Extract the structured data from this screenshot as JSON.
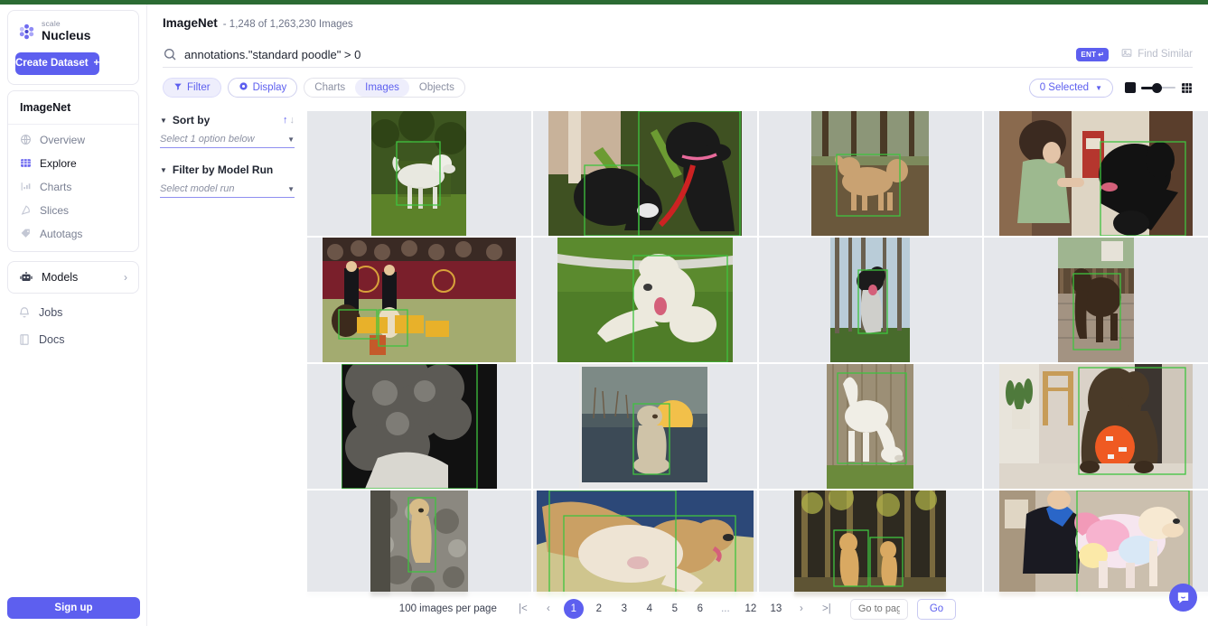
{
  "brand": {
    "company": "scale",
    "product": "Nucleus",
    "logo_icon": "scale-flower-icon"
  },
  "sidebar": {
    "create_dataset": "Create Dataset",
    "dataset_name": "ImageNet",
    "items": [
      {
        "label": "Overview",
        "icon": "globe-icon",
        "active": false
      },
      {
        "label": "Explore",
        "icon": "grid-table-icon",
        "active": true
      },
      {
        "label": "Charts",
        "icon": "bar-chart-icon",
        "active": false
      },
      {
        "label": "Slices",
        "icon": "slice-icon",
        "active": false
      },
      {
        "label": "Autotags",
        "icon": "tag-icon",
        "active": false
      }
    ],
    "models": {
      "label": "Models",
      "icon": "robot-icon",
      "chevron": "chevron-right-icon"
    },
    "lower": [
      {
        "label": "Jobs",
        "icon": "bell-icon"
      },
      {
        "label": "Docs",
        "icon": "book-icon"
      }
    ],
    "signup": "Sign up"
  },
  "header": {
    "title": "ImageNet",
    "subtitle": "- 1,248 of 1,263,230 Images"
  },
  "search": {
    "value": "annotations.\"standard poodle\" > 0",
    "icon": "search-icon",
    "ent_badge": "ENT",
    "ent_glyph": "↵",
    "find_similar": "Find Similar",
    "find_similar_icon": "image-similar-icon"
  },
  "toolbar": {
    "filter": "Filter",
    "filter_icon": "funnel-icon",
    "display": "Display",
    "display_icon": "eye-icon",
    "tabs": [
      {
        "label": "Charts",
        "active": false
      },
      {
        "label": "Images",
        "active": true
      },
      {
        "label": "Objects",
        "active": false
      }
    ],
    "selected": "0 Selected",
    "selected_caret": "▼",
    "size_small_icon": "square-small-icon",
    "size_slider_icon": "size-slider",
    "grid_icon": "grid-density-icon"
  },
  "filters": {
    "sort_by": {
      "label": "Sort by",
      "placeholder": "Select 1 option below",
      "asc_icon": "arrow-up-icon",
      "desc_icon": "arrow-down-icon"
    },
    "model_run": {
      "label": "Filter by Model Run",
      "placeholder": "Select model run"
    }
  },
  "grid": {
    "cells": [
      {
        "name": "white-poodle-standing-on-grass",
        "bg": "#2d3d1a",
        "orient": "portrait"
      },
      {
        "name": "two-black-poodles-with-pink-collar-red-leash",
        "bg": "#2c3a22",
        "orient": "landscape"
      },
      {
        "name": "apricot-poodle-in-woods",
        "bg": "#5b4c38",
        "orient": "portrait"
      },
      {
        "name": "child-with-black-poodle-indoors",
        "bg": "#4a3a32",
        "orient": "landscape"
      },
      {
        "name": "dog-show-ring-with-handlers",
        "bg": "#6b3038",
        "orient": "landscape"
      },
      {
        "name": "white-poodle-lying-on-grass",
        "bg": "#3f5c25",
        "orient": "landscape"
      },
      {
        "name": "black-and-white-poodle-running-in-forest",
        "bg": "#7d8ca0",
        "orient": "portrait"
      },
      {
        "name": "brown-poodle-on-deck",
        "bg": "#4a3b2d",
        "orient": "portrait"
      },
      {
        "name": "close-up-grey-curly-poodle-coat",
        "bg": "#4d4d4a",
        "orient": "portrait"
      },
      {
        "name": "cream-poodle-at-sunset-on-snow",
        "bg": "#2f3b48",
        "orient": "portrait"
      },
      {
        "name": "white-poodle-by-wooden-fence",
        "bg": "#8a7f6b",
        "orient": "portrait"
      },
      {
        "name": "brown-poodle-with-orange-ball-indoors",
        "bg": "#c4b9ae",
        "orient": "landscape"
      },
      {
        "name": "apricot-poodle-on-rocky-path",
        "bg": "#6e6a61",
        "orient": "portrait"
      },
      {
        "name": "poodle-lying-on-blue-blanket",
        "bg": "#3b4f78",
        "orient": "landscape"
      },
      {
        "name": "two-apricot-poodles-in-birch-woods",
        "bg": "#6d6a3c",
        "orient": "portrait"
      },
      {
        "name": "rainbow-dyed-poodle-with-groomer",
        "bg": "#c9b7a6",
        "orient": "landscape"
      }
    ],
    "box_color": "#3fc33f"
  },
  "pagination": {
    "per_page": "100 images per page",
    "first": "|<",
    "prev": "‹",
    "next": "›",
    "last": ">|",
    "pages": [
      "1",
      "2",
      "3",
      "4",
      "5",
      "6",
      "...",
      "12",
      "13"
    ],
    "current": "1",
    "goto_placeholder": "Go to page",
    "go": "Go"
  },
  "chat": {
    "icon": "chat-bubble-icon"
  },
  "colors": {
    "accent": "#5d5fef",
    "top_strip": "#2b6b33",
    "cell_bg": "#e5e7eb",
    "box": "#3fc33f"
  }
}
